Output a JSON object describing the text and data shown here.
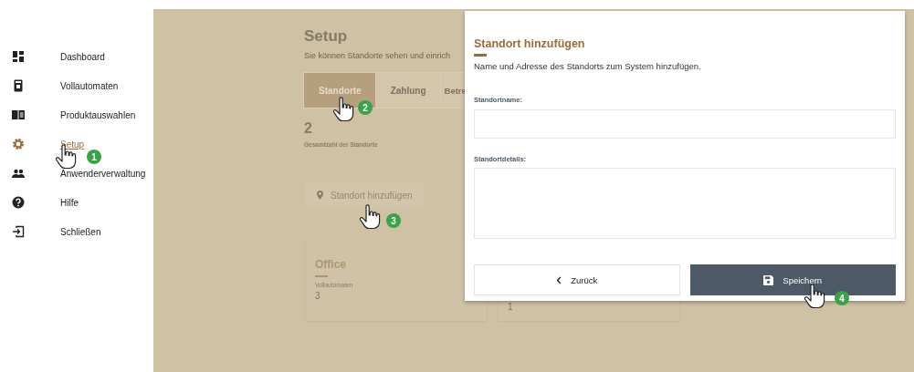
{
  "sidebar": {
    "items": [
      {
        "label": "Dashboard",
        "selected": false
      },
      {
        "label": "Vollautomaten",
        "selected": false
      },
      {
        "label": "Produktauswahlen",
        "selected": false
      },
      {
        "label": "Setup",
        "selected": true
      },
      {
        "label": "Anwenderverwaltung",
        "selected": false
      },
      {
        "label": "Hilfe",
        "selected": false
      },
      {
        "label": "Schließen",
        "selected": false
      }
    ]
  },
  "page": {
    "title": "Setup",
    "subtitle": "Sie können Standorte sehen und einrich",
    "tabs": [
      {
        "label": "Standorte",
        "selected": true
      },
      {
        "label": "Zahlung",
        "selected": false
      },
      {
        "label": "Betre",
        "selected": false
      }
    ],
    "count": "2",
    "count_label": "Gesamtzahl der Standorte",
    "add_button": "Standort hinzufügen",
    "cards": [
      {
        "title": "Office",
        "label": "Vollautomaten",
        "value": "3"
      },
      {
        "value": "1"
      }
    ]
  },
  "dialog": {
    "title": "Standort hinzufügen",
    "description": "Name und Adresse des Standorts zum System hinzufügen.",
    "fields": [
      {
        "label": "Standortname:",
        "kind": "input"
      },
      {
        "label": "Standortdetails:",
        "kind": "textarea"
      }
    ],
    "back_button": "Zurück",
    "save_button": "Speichern"
  },
  "annotations": [
    {
      "number": "1"
    },
    {
      "number": "2"
    },
    {
      "number": "3"
    },
    {
      "number": "4"
    }
  ]
}
